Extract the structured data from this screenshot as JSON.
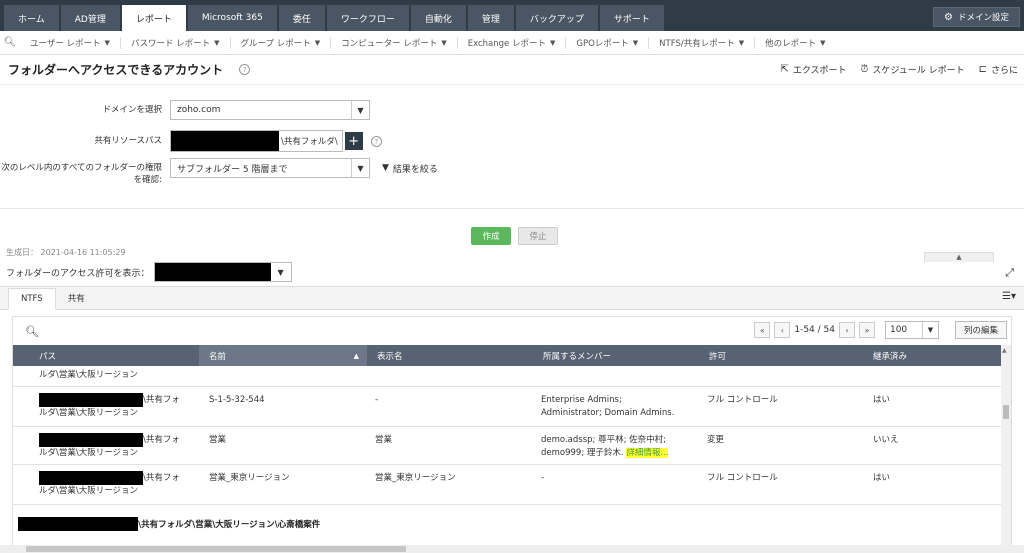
{
  "topnav": {
    "tabs": [
      "ホーム",
      "AD管理",
      "レポート",
      "Microsoft 365",
      "委任",
      "ワークフロー",
      "自動化",
      "管理",
      "バックアップ",
      "サポート"
    ],
    "active_index": 2,
    "domain_settings": "ドメイン設定"
  },
  "subnav": {
    "items": [
      "ユーザー レポート",
      "パスワード レポート",
      "グループ レポート",
      "コンピューター レポート",
      "Exchange レポート",
      "GPOレポート",
      "NTFS/共有レポート",
      "他のレポート"
    ]
  },
  "page": {
    "title": "フォルダーへアクセスできるアカウント",
    "export": "エクスポート",
    "schedule": "スケジュール レポート",
    "more": "さらに"
  },
  "form": {
    "domain_label": "ドメインを選択",
    "domain_value": "zoho.com",
    "share_label": "共有リソースパス",
    "share_value": "\\共有フォルダ\\",
    "level_label_1": "次のレベル内のすべてのフォルダーの権限",
    "level_label_2": "を確認:",
    "level_value": "サブフォルダー 5 階層まで",
    "filter": "結果を絞る"
  },
  "buttons": {
    "create": "作成",
    "stop": "停止"
  },
  "result": {
    "generated": "生成日： 2021-04-16 11:05:29",
    "show_perm_label": "フォルダーのアクセス許可を表示：",
    "tabs": [
      "NTFS",
      "共有"
    ],
    "pager": {
      "first": "«",
      "prev": "‹",
      "range": "1-54 / 54",
      "next": "›",
      "last": "»",
      "per_page": "100",
      "edit_columns": "列の編集"
    },
    "columns": [
      "パス",
      "名前",
      "表示名",
      "所属するメンバー",
      "許可",
      "継承済み"
    ],
    "rows": [
      {
        "path": "ルダ\\営業\\大阪リージョン"
      },
      {
        "path1": "\\共有フォ",
        "path2": "ルダ\\営業\\大阪リージョン",
        "name": "S-1-5-32-544",
        "display": "-",
        "members1": "Enterprise Admins;",
        "members2": "Administrator; Domain Admins.",
        "perm": "フル コントロール",
        "inherit": "はい"
      },
      {
        "path1": "\\共有フォ",
        "path2": "ルダ\\営業\\大阪リージョン",
        "name": "営業",
        "display": "営業",
        "members1": "demo.adssp; 尊平林; 佐奈中村;",
        "members2": "demo999; 理子鈴木.",
        "more": "詳細情報...",
        "perm": "変更",
        "inherit": "いいえ"
      },
      {
        "path1": "\\共有フォ",
        "path2": "ルダ\\営業\\大阪リージョン",
        "name": "営業_東京リージョン",
        "display": "営業_東京リージョン",
        "members1": "-",
        "perm": "フル コントロール",
        "inherit": "はい"
      }
    ],
    "footer_path": "\\共有フォルダ\\営業\\大阪リージョン\\心斎橋案件"
  }
}
